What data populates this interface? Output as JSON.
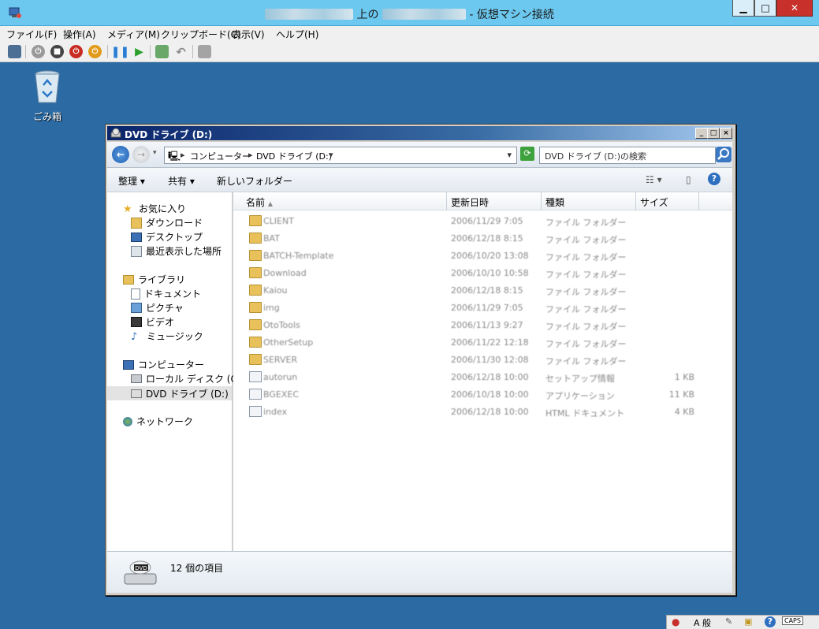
{
  "host": {
    "title_prefix": "上の",
    "title_suffix": "- 仮想マシン接続",
    "caption": {
      "minimize": "▁",
      "maximize": "□",
      "close": "✕"
    },
    "menu": [
      "ファイル(F)",
      "操作(A)",
      "メディア(M)",
      "クリップボード(C)",
      "表示(V)",
      "ヘルプ(H)"
    ],
    "toolbar_icons": [
      "ctrl-alt-del-icon",
      "start-icon",
      "stop-icon",
      "shutdown-icon",
      "power-icon",
      "pause-icon",
      "resume-icon",
      "checkpoint-icon",
      "revert-icon",
      "enhanced-session-icon"
    ]
  },
  "desktop": {
    "recycle_bin_label": "ごみ箱"
  },
  "explorer": {
    "title": "DVD ドライブ (D:)",
    "address": {
      "computer": "コンピューター",
      "drive": "DVD ドライブ (D:)"
    },
    "search_placeholder": "DVD ドライブ (D:)の検索",
    "commands": {
      "organize": "整理",
      "share": "共有",
      "new_folder": "新しいフォルダー"
    },
    "nav": {
      "favorites": "お気に入り",
      "downloads": "ダウンロード",
      "desktop": "デスクトップ",
      "recent": "最近表示した場所",
      "libraries": "ライブラリ",
      "documents": "ドキュメント",
      "pictures": "ピクチャ",
      "videos": "ビデオ",
      "music": "ミュージック",
      "computer": "コンピューター",
      "local_disk": "ローカル ディスク (C:)",
      "dvd_drive": "DVD ドライブ (D:)",
      "network": "ネットワーク"
    },
    "columns": {
      "name": "名前",
      "modified": "更新日時",
      "type": "種類",
      "size": "サイズ"
    },
    "files": [
      {
        "name": "CLIENT",
        "modified": "2006/11/29 7:05",
        "type": "ファイル フォルダー",
        "size": "",
        "kind": "folder"
      },
      {
        "name": "BAT",
        "modified": "2006/12/18 8:15",
        "type": "ファイル フォルダー",
        "size": "",
        "kind": "folder"
      },
      {
        "name": "BATCH-Template",
        "modified": "2006/10/20 13:08",
        "type": "ファイル フォルダー",
        "size": "",
        "kind": "folder"
      },
      {
        "name": "Download",
        "modified": "2006/10/10 10:58",
        "type": "ファイル フォルダー",
        "size": "",
        "kind": "folder"
      },
      {
        "name": "Kaiou",
        "modified": "2006/12/18 8:15",
        "type": "ファイル フォルダー",
        "size": "",
        "kind": "folder"
      },
      {
        "name": "img",
        "modified": "2006/11/29 7:05",
        "type": "ファイル フォルダー",
        "size": "",
        "kind": "folder"
      },
      {
        "name": "OtoTools",
        "modified": "2006/11/13 9:27",
        "type": "ファイル フォルダー",
        "size": "",
        "kind": "folder"
      },
      {
        "name": "OtherSetup",
        "modified": "2006/11/22 12:18",
        "type": "ファイル フォルダー",
        "size": "",
        "kind": "folder"
      },
      {
        "name": "SERVER",
        "modified": "2006/11/30 12:08",
        "type": "ファイル フォルダー",
        "size": "",
        "kind": "folder"
      },
      {
        "name": "autorun",
        "modified": "2006/12/18 10:00",
        "type": "セットアップ情報",
        "size": "1 KB",
        "kind": "file"
      },
      {
        "name": "BGEXEC",
        "modified": "2006/10/18 10:00",
        "type": "アプリケーション",
        "size": "11 KB",
        "kind": "file"
      },
      {
        "name": "index",
        "modified": "2006/12/18 10:00",
        "type": "HTML ドキュメント",
        "size": "4 KB",
        "kind": "file"
      }
    ],
    "status": "12 個の項目",
    "drive_badge": "DVD"
  },
  "tray": {
    "ime": "A 般",
    "caps": "CAPS"
  },
  "colors": {
    "desktop": "#2b6aa3",
    "host_title": "#6cc8ef",
    "close_red": "#c7302b",
    "folder": "#e8c15a"
  }
}
